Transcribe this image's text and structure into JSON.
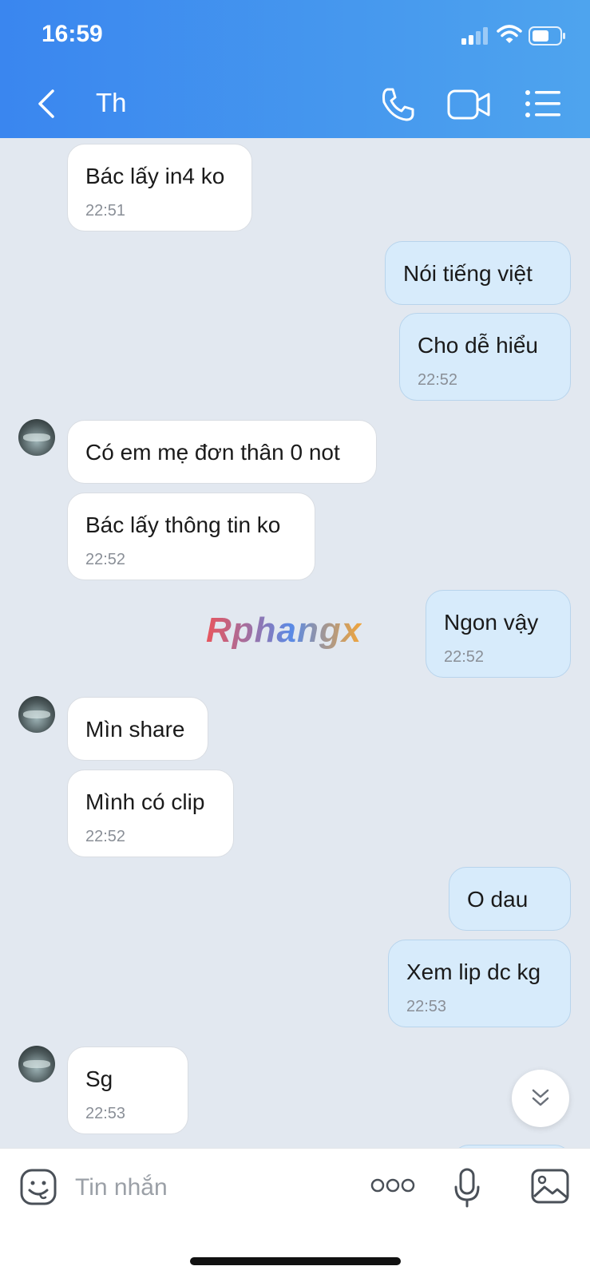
{
  "status_bar": {
    "time": "16:59"
  },
  "header": {
    "contact_name": "Th"
  },
  "watermark": "Rphangx",
  "messages": [
    {
      "side": "in",
      "text": "Bác lấy in4 ko",
      "time": "22:51"
    },
    {
      "side": "out",
      "text": "Nói tiếng việt",
      "time": ""
    },
    {
      "side": "out",
      "text": "Cho dễ hiểu",
      "time": "22:52"
    },
    {
      "side": "in",
      "text": "Có em mẹ đơn thân 0 not",
      "time": ""
    },
    {
      "side": "in",
      "text": "Bác lấy thông tin ko",
      "time": "22:52"
    },
    {
      "side": "out",
      "text": "Ngon vậy",
      "time": "22:52"
    },
    {
      "side": "in",
      "text": "Mìn share",
      "time": ""
    },
    {
      "side": "in",
      "text": "Mình có clip",
      "time": "22:52"
    },
    {
      "side": "out",
      "text": "O dau",
      "time": ""
    },
    {
      "side": "out",
      "text": "Xem lip dc kg",
      "time": "22:53"
    },
    {
      "side": "in",
      "text": "Sg",
      "time": "22:53"
    }
  ],
  "composer": {
    "placeholder": "Tin nhắn"
  },
  "icons": {
    "back": "chevron-left-icon",
    "call": "phone-icon",
    "video": "video-camera-icon",
    "menu": "list-icon",
    "emoji": "sticker-icon",
    "more": "more-dots-icon",
    "mic": "microphone-icon",
    "image": "image-icon",
    "scroll": "double-chevron-down-icon"
  },
  "colors": {
    "header_start": "#3a86ef",
    "header_end": "#4ea4ee",
    "chat_background": "#e2e8f0",
    "incoming_bubble": "#ffffff",
    "outgoing_bubble": "#d7ebfb"
  }
}
